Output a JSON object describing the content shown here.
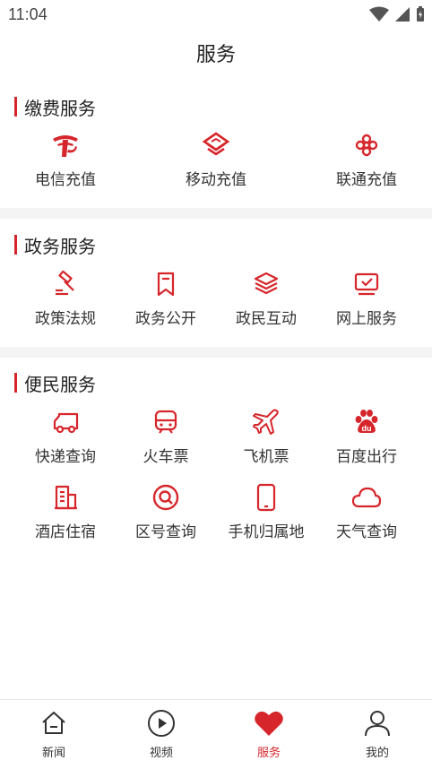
{
  "status": {
    "time": "11:04"
  },
  "header": {
    "title": "服务"
  },
  "sections": {
    "payment": {
      "title": "缴费服务",
      "items": [
        {
          "label": "电信充值",
          "icon": "telecom-logo-icon"
        },
        {
          "label": "移动充值",
          "icon": "mobile-logo-icon"
        },
        {
          "label": "联通充值",
          "icon": "unicom-logo-icon"
        }
      ]
    },
    "government": {
      "title": "政务服务",
      "items": [
        {
          "label": "政策法规",
          "icon": "gavel-icon"
        },
        {
          "label": "政务公开",
          "icon": "bookmark-icon"
        },
        {
          "label": "政民互动",
          "icon": "layers-icon"
        },
        {
          "label": "网上服务",
          "icon": "monitor-check-icon"
        }
      ]
    },
    "convenience": {
      "title": "便民服务",
      "items": [
        {
          "label": "快递查询",
          "icon": "truck-icon"
        },
        {
          "label": "火车票",
          "icon": "train-icon"
        },
        {
          "label": "飞机票",
          "icon": "airplane-icon"
        },
        {
          "label": "百度出行",
          "icon": "baidu-paw-icon"
        },
        {
          "label": "酒店住宿",
          "icon": "building-icon"
        },
        {
          "label": "区号查询",
          "icon": "search-icon"
        },
        {
          "label": "手机归属地",
          "icon": "phone-icon"
        },
        {
          "label": "天气查询",
          "icon": "cloud-icon"
        }
      ]
    }
  },
  "tabbar": {
    "items": [
      {
        "label": "新闻",
        "icon": "home-icon"
      },
      {
        "label": "视频",
        "icon": "play-icon"
      },
      {
        "label": "服务",
        "icon": "heart-icon",
        "active": true
      },
      {
        "label": "我的",
        "icon": "user-icon"
      }
    ]
  },
  "colors": {
    "accent": "#d6262b",
    "divider": "#f4f4f4"
  }
}
